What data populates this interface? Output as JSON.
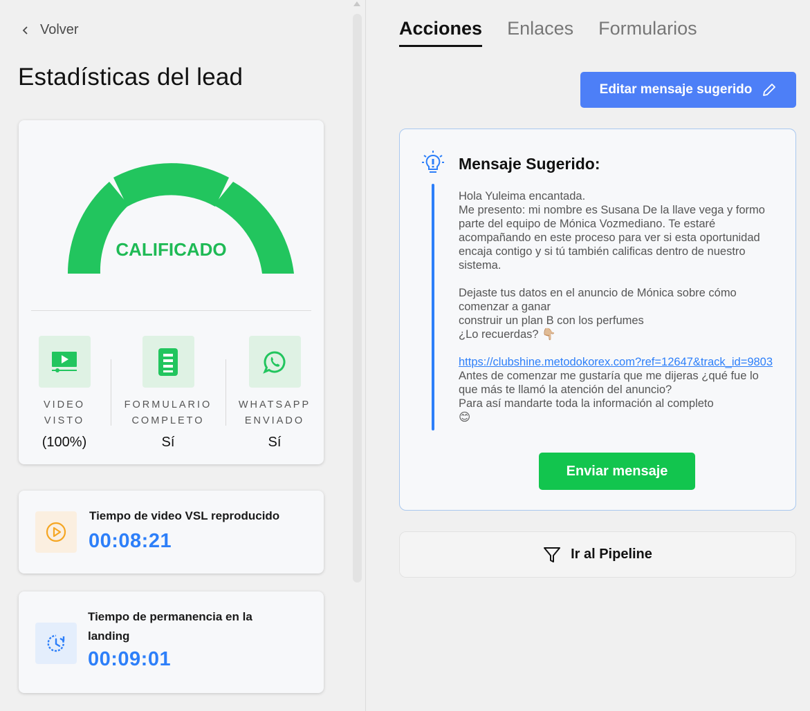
{
  "nav": {
    "back_label": "Volver"
  },
  "page": {
    "title": "Estadísticas del lead"
  },
  "gauge": {
    "status_label": "CALIFICADO",
    "color": "#1fba55",
    "segments_filled": 3,
    "segments_total": 3
  },
  "stats": [
    {
      "label_line1": "VIDEO",
      "label_line2": "VISTO",
      "value": "(100%)",
      "icon": "video-play-icon"
    },
    {
      "label_line1": "FORMULARIO",
      "label_line2": "COMPLETO",
      "value": "Sí",
      "icon": "form-document-icon"
    },
    {
      "label_line1": "WHATSAPP",
      "label_line2": "ENVIADO",
      "value": "Sí",
      "icon": "whatsapp-icon"
    }
  ],
  "times": [
    {
      "title": "Tiempo de video VSL reproducido",
      "value": "00:08:21",
      "icon": "play-circle-icon",
      "accent": "#f5a623"
    },
    {
      "title": "Tiempo de permanencia en la landing",
      "value": "00:09:01",
      "icon": "clock-history-icon",
      "accent": "#2d7ff9"
    }
  ],
  "tabs": [
    {
      "label": "Acciones",
      "active": true
    },
    {
      "label": "Enlaces",
      "active": false
    },
    {
      "label": "Formularios",
      "active": false
    }
  ],
  "actions": {
    "edit_button_label": "Editar mensaje sugerido",
    "message_title": "Mensaje Sugerido:",
    "message_p1": "Hola Yuleima encantada.",
    "message_p2": "Me presento: mi nombre es Susana De la llave vega y formo parte del equipo de Mónica Vozmediano. Te estaré acompañando en este proceso para ver si esta oportunidad encaja contigo y si tú también calificas dentro de nuestro sistema.",
    "message_p3": "Dejaste tus datos en el anuncio de Mónica sobre cómo comenzar a ganar",
    "message_p4": "construir un plan B con los perfumes",
    "message_p5": "¿Lo recuerdas? 👇🏼",
    "message_link": "https://clubshine.metodokorex.com?ref=12647&track_id=9803",
    "message_p6": "Antes de comenzar me gustaría que me dijeras ¿qué fue lo que más te llamó la atención del anuncio?",
    "message_p7": "Para así mandarte toda la información al completo",
    "message_emoji": "😊",
    "send_button_label": "Enviar mensaje",
    "pipeline_button_label": "Ir al Pipeline"
  },
  "colors": {
    "primary_blue": "#4d7ff7",
    "send_green": "#12c54e",
    "icon_green": "#22c55e"
  }
}
